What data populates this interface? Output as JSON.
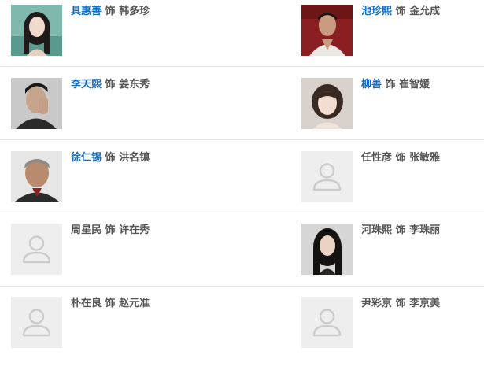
{
  "cast": [
    {
      "actor": "具惠善",
      "linked": true,
      "separator": "饰",
      "role": "韩多珍",
      "photo": "portrait-photo"
    },
    {
      "actor": "池珍熙",
      "linked": true,
      "separator": "饰",
      "role": "金允成",
      "photo": "portrait-photo"
    },
    {
      "actor": "李天熙",
      "linked": true,
      "separator": "饰",
      "role": "姜东秀",
      "photo": "portrait-photo"
    },
    {
      "actor": "柳善",
      "linked": true,
      "separator": "饰",
      "role": "崔智媛",
      "photo": "portrait-photo"
    },
    {
      "actor": "徐仁锡",
      "linked": true,
      "separator": "饰",
      "role": "洪名镇",
      "photo": "portrait-photo"
    },
    {
      "actor": "任性彦",
      "linked": false,
      "separator": "饰",
      "role": "张敏雅",
      "photo": "default-avatar-icon"
    },
    {
      "actor": "周星民",
      "linked": false,
      "separator": "饰",
      "role": "许在秀",
      "photo": "default-avatar-icon"
    },
    {
      "actor": "河珠熙",
      "linked": false,
      "separator": "饰",
      "role": "李珠丽",
      "photo": "portrait-photo"
    },
    {
      "actor": "朴在良",
      "linked": false,
      "separator": "饰",
      "role": "赵元准",
      "photo": "default-avatar-icon"
    },
    {
      "actor": "尹彩京",
      "linked": false,
      "separator": "饰",
      "role": "李京美",
      "photo": "default-avatar-icon"
    }
  ],
  "colors": {
    "link": "#136ec2",
    "text": "#555555",
    "divider": "#e6e6e6",
    "placeholder_bg": "#eeeeee",
    "placeholder_icon": "#cccccc"
  }
}
